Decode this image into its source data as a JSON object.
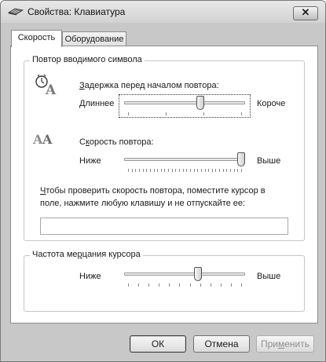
{
  "window": {
    "title": "Свойства: Клавиатура",
    "close_glyph": "✕"
  },
  "tabs": [
    {
      "label": "Скорость",
      "active": true
    },
    {
      "label": "Оборудование",
      "active": false
    }
  ],
  "repeat_group": {
    "title": "Повтор вводимого символа",
    "delay": {
      "label_underlined": "З",
      "label_rest": "адержка перед началом повтора:",
      "left": "Длиннее",
      "right": "Короче",
      "value_fraction": 0.64,
      "ticks": 4
    },
    "rate": {
      "label_first": "С",
      "label_underlined": "к",
      "label_rest": "орость повтора:",
      "left": "Ниже",
      "right": "Выше",
      "value_fraction": 1.0,
      "ticks": 32
    },
    "test_hint_underlined": "Ч",
    "test_hint_rest": "тобы проверить скорость повтора, поместите курсор в",
    "test_hint_line2": "поле, нажмите любую клавишу и не отпускайте ее:",
    "test_value": ""
  },
  "blink_group": {
    "title_first": "Частота ме",
    "title_underlined": "р",
    "title_rest": "цания курсора",
    "left": "Ниже",
    "right": "Выше",
    "value_fraction": 0.62,
    "ticks": 12
  },
  "buttons": {
    "ok": "ОК",
    "cancel": "Отмена",
    "apply_first": "При",
    "apply_underlined": "м",
    "apply_rest": "енить"
  }
}
